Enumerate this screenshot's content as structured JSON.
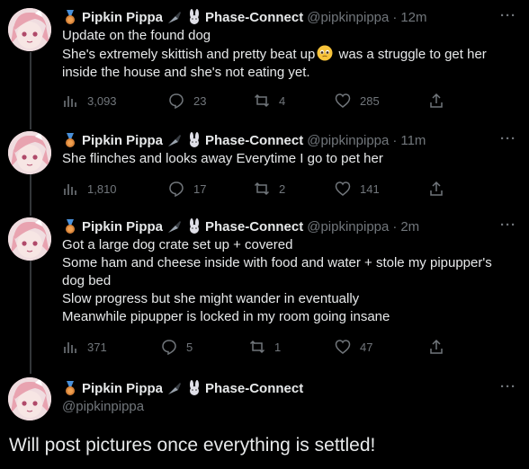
{
  "author": {
    "name": "Pipkin Pippa",
    "affiliation": "Phase-Connect",
    "handle": "@pipkinpippa"
  },
  "colors": {
    "background": "#000000",
    "text": "#e7e9ea",
    "secondary": "#71767b",
    "thread_line": "#333639"
  },
  "icons": {
    "badge": "bronze-medal-icon",
    "knife": "knife-icon",
    "rabbit": "rabbit-icon",
    "views": "bar-chart-icon",
    "reply": "reply-icon",
    "retweet": "retweet-icon",
    "like": "heart-icon",
    "share": "share-icon"
  },
  "more_label": "···",
  "dot": "·",
  "tweets": [
    {
      "time": "12m",
      "text_line1": "Update on the found dog",
      "text_line2a": "She's extremely skittish and pretty beat up",
      "text_line2b": "was a struggle to get her",
      "text_line3": "inside the house and she's not eating yet.",
      "views": "3,093",
      "replies": "23",
      "retweets": "4",
      "likes": "285"
    },
    {
      "time": "11m",
      "text_line1": "She flinches and looks away Everytime I go to pet her",
      "views": "1,810",
      "replies": "17",
      "retweets": "2",
      "likes": "141"
    },
    {
      "time": "2m",
      "text_line1": "Got a large dog crate set up + covered",
      "text_line2": "Some ham and cheese inside with food and water + stole my pipupper's",
      "text_line3": "dog bed",
      "text_line4": "Slow progress but she might wander in eventually",
      "text_line5": "Meanwhile pipupper is locked in my room going insane",
      "views": "371",
      "replies": "5",
      "retweets": "1",
      "likes": "47"
    },
    {
      "text": "Will post pictures once everything is settled!"
    }
  ]
}
